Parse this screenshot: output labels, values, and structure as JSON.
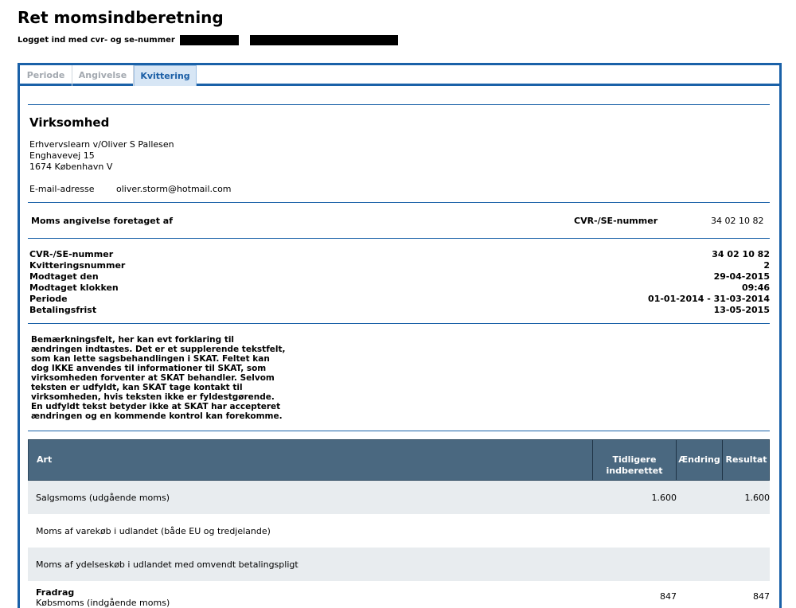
{
  "header": {
    "title": "Ret momsindberetning",
    "login_text": "Logget ind med cvr- og se-nummer"
  },
  "tabs": [
    {
      "label": "Periode"
    },
    {
      "label": "Angivelse"
    },
    {
      "label": "Kvittering"
    }
  ],
  "company": {
    "heading": "Virksomhed",
    "name": "Erhvervslearn v/Oliver S Pallesen",
    "street": "Enghavevej 15",
    "city": "1674 København V",
    "email_label": "E-mail-adresse",
    "email_value": "oliver.storm@hotmail.com"
  },
  "declared_by": {
    "label": "Moms angivelse foretaget af",
    "cvr_label": "CVR-/SE-nummer",
    "cvr_value": "34 02 10 82"
  },
  "receipt": {
    "rows": [
      {
        "label": "CVR-/SE-nummer",
        "value": "34 02 10 82"
      },
      {
        "label": "Kvitteringsnummer",
        "value": "2"
      },
      {
        "label": "Modtaget den",
        "value": "29-04-2015"
      },
      {
        "label": "Modtaget klokken",
        "value": "09:46"
      },
      {
        "label": "Periode",
        "value": "01-01-2014 - 31-03-2014"
      },
      {
        "label": "Betalingsfrist",
        "value": "13-05-2015"
      }
    ]
  },
  "remark": "Bemærkningsfelt, her kan evt forklaring til ændringen indtastes. Det er et supplerende tekstfelt, som kan lette sagsbehandlingen i SKAT. Feltet kan dog IKKE anvendes til informationer til SKAT, som virksomheden forventer at SKAT behandler. Selvom teksten er udfyldt, kan SKAT tage kontakt til virksomheden, hvis teksten ikke er fyldestgørende. En udfyldt tekst betyder ikke at SKAT har accepteret ændringen og en kommende kontrol kan forekomme.",
  "table": {
    "headers": {
      "art": "Art",
      "tidligere": "Tidligere indberettet",
      "aendring": "Ændring",
      "resultat": "Resultat"
    },
    "rows": [
      {
        "label": "Salgsmoms (udgående moms)",
        "tidligere": "1.600",
        "resultat": "1.600"
      },
      {
        "label": "Moms af varekøb i udlandet (både EU og tredjelande)",
        "tidligere": "",
        "resultat": ""
      },
      {
        "label": "Moms af ydelseskøb i udlandet med omvendt betalingspligt",
        "tidligere": "",
        "resultat": ""
      },
      {
        "group": "Fradrag",
        "label": "Købsmoms (indgående moms)",
        "tidligere": "847",
        "resultat": "847"
      }
    ]
  }
}
